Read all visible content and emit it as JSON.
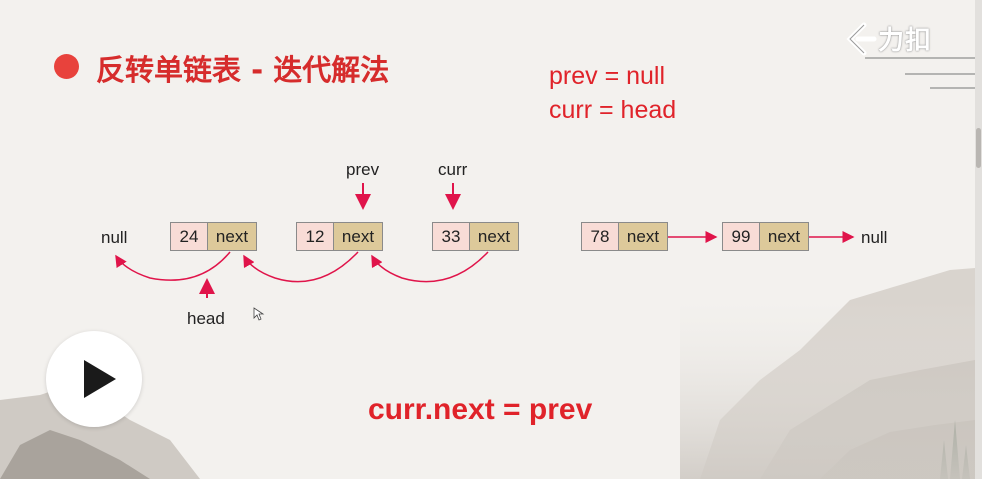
{
  "slide": {
    "title": "反转单链表 - 迭代解法",
    "init_lines": [
      "prev = null",
      "curr = head"
    ],
    "formula": "curr.next = prev"
  },
  "list": {
    "left_null": "null",
    "right_null": "null",
    "nodes": [
      {
        "value": "24",
        "next": "next"
      },
      {
        "value": "12",
        "next": "next"
      },
      {
        "value": "33",
        "next": "next"
      },
      {
        "value": "78",
        "next": "next"
      },
      {
        "value": "99",
        "next": "next"
      }
    ],
    "pointers": {
      "prev": "prev",
      "curr": "curr",
      "head": "head"
    }
  },
  "logo": {
    "text": "力扣"
  },
  "colors": {
    "accent_red": "#e0232a",
    "title_red": "#d62c2c",
    "node_value_bg": "#f8dcd6",
    "node_next_bg": "#ddc99a"
  },
  "player": {
    "icon": "play-icon"
  }
}
